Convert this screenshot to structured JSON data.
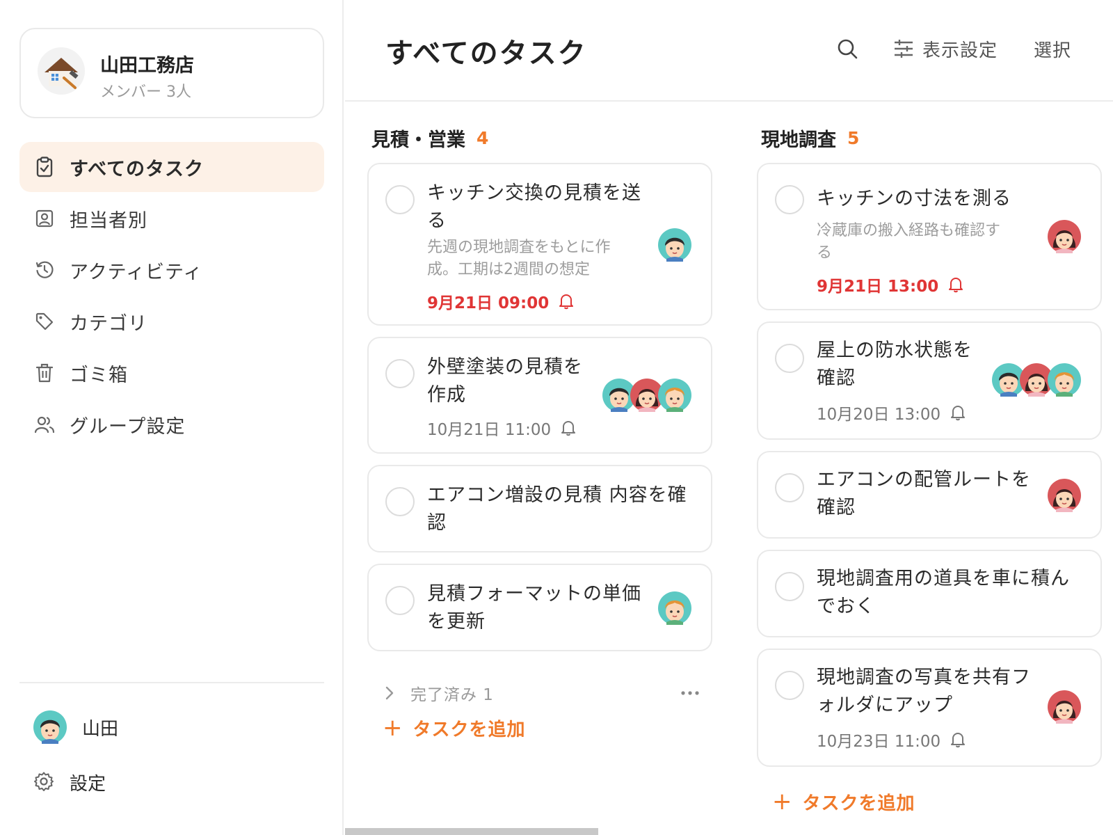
{
  "team": {
    "name": "山田工務店",
    "members": "メンバー 3人"
  },
  "nav": [
    {
      "label": "すべてのタスク",
      "icon": "clipboard-check-icon",
      "active": true
    },
    {
      "label": "担当者別",
      "icon": "person-badge-icon"
    },
    {
      "label": "アクティビティ",
      "icon": "history-icon"
    },
    {
      "label": "カテゴリ",
      "icon": "tag-icon"
    },
    {
      "label": "ゴミ箱",
      "icon": "trash-icon"
    },
    {
      "label": "グループ設定",
      "icon": "users-icon"
    }
  ],
  "user": {
    "name": "山田"
  },
  "settings": {
    "label": "設定"
  },
  "header": {
    "title": "すべてのタスク",
    "view_settings": "表示設定",
    "select": "選択"
  },
  "columns": [
    {
      "title": "見積・営業",
      "count": "4",
      "tasks": [
        {
          "title_lines": [
            "キッチン交換の見積を送",
            "る"
          ],
          "desc_lines": [
            "先週の現地調査をもとに作",
            "成。工期は2週間の想定"
          ],
          "due": "9月21日 09:00",
          "overdue": true,
          "assignees": [
            "boy"
          ]
        },
        {
          "title_lines": [
            "外壁塗装の見積を",
            "作成"
          ],
          "due": "10月21日 11:00",
          "overdue": false,
          "assignees": [
            "boy",
            "girl",
            "orange"
          ]
        },
        {
          "title_lines": [
            "エアコン増設の見積 内容を確",
            "認"
          ],
          "assignees": []
        },
        {
          "title_lines": [
            "見積フォーマットの単価",
            "を更新"
          ],
          "assignees": [
            "orange"
          ]
        }
      ],
      "completed_label": "完了済み 1",
      "add_task": "タスクを追加"
    },
    {
      "title": "現地調査",
      "count": "5",
      "tasks": [
        {
          "title_lines": [
            "キッチンの寸法を測る"
          ],
          "desc_lines": [
            "冷蔵庫の搬入経路も確認す",
            "る"
          ],
          "due": "9月21日 13:00",
          "overdue": true,
          "assignees": [
            "girl"
          ]
        },
        {
          "title_lines": [
            "屋上の防水状態を",
            "確認"
          ],
          "due": "10月20日 13:00",
          "overdue": false,
          "assignees": [
            "boy",
            "girl",
            "orange"
          ]
        },
        {
          "title_lines": [
            "エアコンの配管ルートを",
            "確認"
          ],
          "assignees": [
            "girl"
          ]
        },
        {
          "title_lines": [
            "現地調査用の道具を車に積ん",
            "でおく"
          ],
          "assignees": []
        },
        {
          "title_lines": [
            "現地調査の写真を共有フ",
            "ォルダにアップ"
          ],
          "due": "10月23日 11:00",
          "overdue": false,
          "assignees": [
            "girl"
          ]
        }
      ],
      "add_task": "タスクを追加"
    }
  ],
  "colors": {
    "accent": "#f07a2a",
    "overdue": "#e03535",
    "active_nav_bg": "#fdf1e7"
  }
}
